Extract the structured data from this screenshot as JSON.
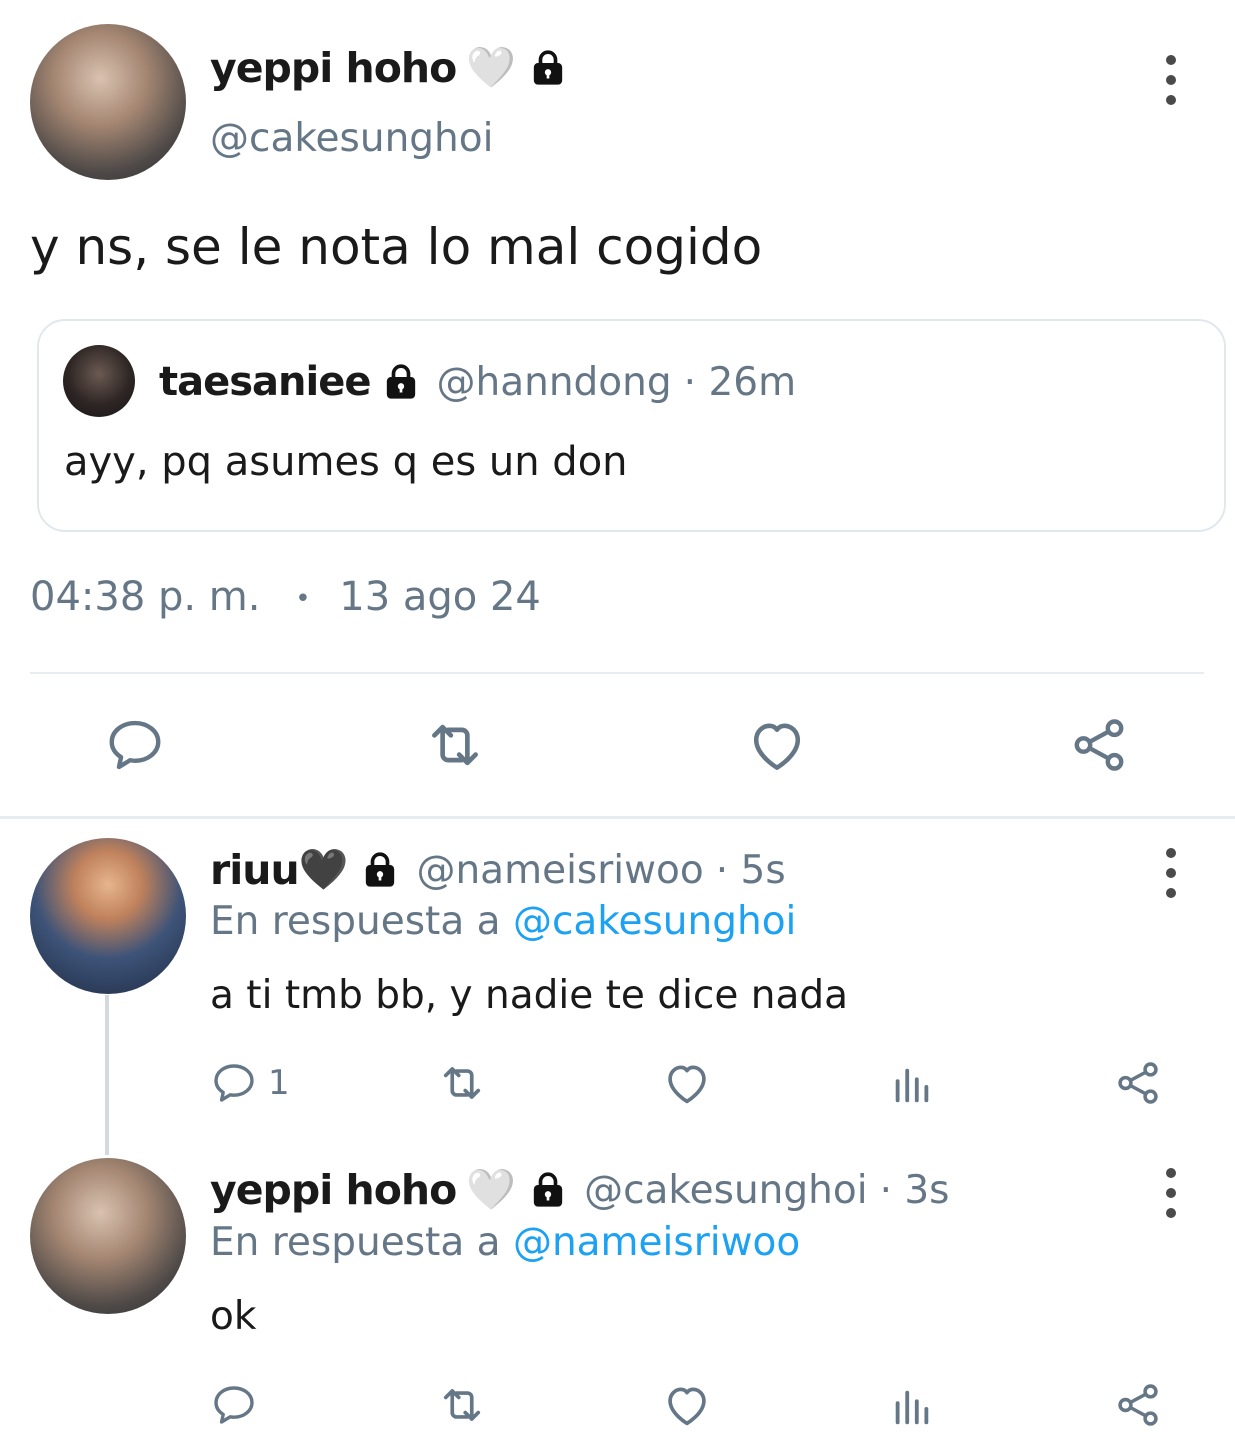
{
  "main_tweet": {
    "author_name": "yeppi hoho",
    "author_emoji": "🤍",
    "author_handle": "@cakesunghoi",
    "text": "y ns, se le nota lo mal cogido",
    "time": "04:38 p. m.",
    "separator": "•",
    "date": "13 ago 24",
    "quoted": {
      "author_name": "taesaniee",
      "author_handle": "@hanndong",
      "time": "· 26m",
      "text": "ayy, pq asumes q es un don"
    }
  },
  "replies": [
    {
      "author_name": "riuu",
      "author_emoji": "🖤",
      "author_handle": "@nameisriwoo",
      "time": "· 5s",
      "reply_prefix": "En respuesta a",
      "reply_to": "@cakesunghoi",
      "text": "a ti tmb bb, y nadie te dice nada",
      "reply_count": "1"
    },
    {
      "author_name": "yeppi hoho",
      "author_emoji": "🤍",
      "author_handle": "@cakesunghoi",
      "time": "· 3s",
      "reply_prefix": "En respuesta a",
      "reply_to": "@nameisriwoo",
      "text": "ok",
      "reply_count": ""
    }
  ],
  "icons": {
    "reply": "reply-icon",
    "retweet": "retweet-icon",
    "like": "heart-icon",
    "views": "views-icon",
    "share": "share-icon",
    "more": "more-icon",
    "lock": "lock-icon"
  },
  "colors": {
    "accent": "#1da1f2",
    "secondary_text": "#657786",
    "icon_gray": "#657786",
    "border": "#e1e8ed"
  }
}
